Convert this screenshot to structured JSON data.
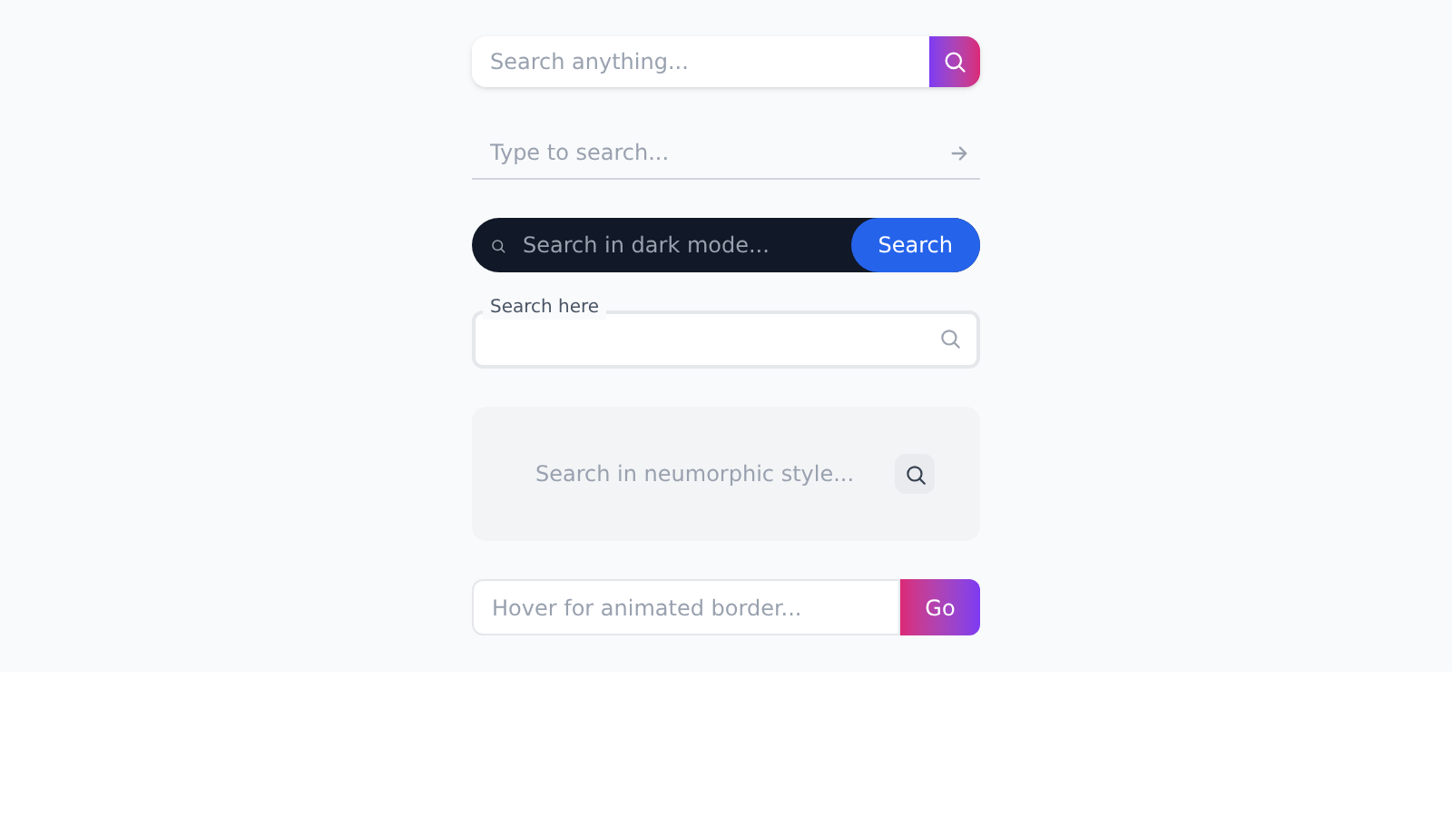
{
  "search_bars": [
    {
      "kind": "gradient",
      "placeholder": "Search anything..."
    },
    {
      "kind": "underline",
      "placeholder": "Type to search..."
    },
    {
      "kind": "dark",
      "placeholder": "Search in dark mode...",
      "button": "Search"
    },
    {
      "kind": "floating_label",
      "label": "Search here"
    },
    {
      "kind": "neumorphic",
      "placeholder": "Search in neumorphic style..."
    },
    {
      "kind": "animated_border",
      "placeholder": "Hover for animated border...",
      "button": "Go"
    }
  ]
}
